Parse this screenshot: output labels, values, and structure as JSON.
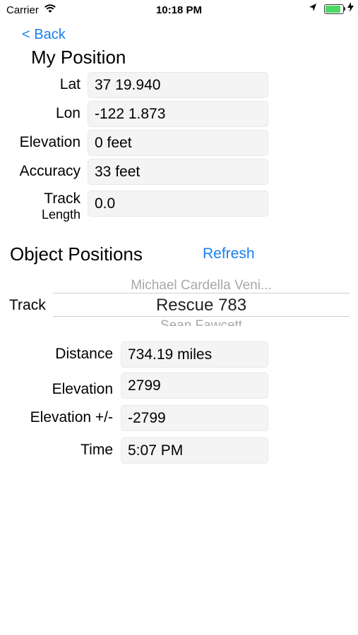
{
  "status_bar": {
    "carrier": "Carrier",
    "time": "10:18 PM",
    "battery_level": 0.95,
    "battery_color": "#4cd964"
  },
  "nav": {
    "back_label": "< Back"
  },
  "my_position": {
    "title": "My Position",
    "fields": [
      {
        "label": "Lat",
        "value": "37 19.940"
      },
      {
        "label": "Lon",
        "value": "-122 1.873"
      },
      {
        "label": "Elevation",
        "value": "0 feet"
      },
      {
        "label": "Accuracy",
        "value": "33 feet"
      },
      {
        "label_line1": "Track",
        "label_line2": "Length",
        "value": "0.0"
      }
    ]
  },
  "object_positions": {
    "title": "Object Positions",
    "refresh_label": "Refresh",
    "track_label": "Track",
    "picker": {
      "above": "Michael Cardella Veni...",
      "selected": "Rescue 783",
      "below": "Sean Fawcett"
    },
    "fields": [
      {
        "label": "Distance",
        "value": "734.19 miles"
      },
      {
        "label": "Elevation",
        "value": "2799"
      },
      {
        "label": "Elevation +/-",
        "value": "-2799"
      },
      {
        "label": "Time",
        "value": "5:07 PM"
      }
    ]
  },
  "colors": {
    "accent": "#1a7ff0",
    "field_bg": "#f4f4f4"
  }
}
